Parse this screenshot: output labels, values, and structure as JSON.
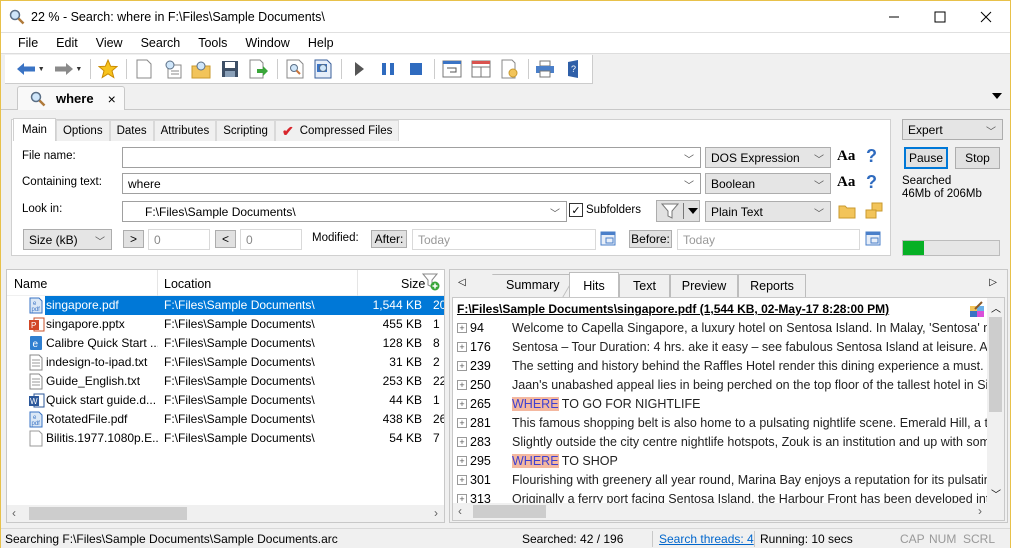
{
  "window": {
    "title": "22 % - Search: where in F:\\Files\\Sample Documents\\",
    "minimize": "—",
    "maximize": "☐",
    "close": "✕"
  },
  "menu": [
    "File",
    "Edit",
    "View",
    "Search",
    "Tools",
    "Window",
    "Help"
  ],
  "toolbar": {
    "icons": [
      "back-icon",
      "forward-icon",
      "favorites-star-icon",
      "new-document-icon",
      "new-search-icon",
      "open-search-icon",
      "save-icon",
      "export-icon",
      "search-file-icon",
      "search-preview-icon",
      "start-icon",
      "pause-icon",
      "stop-icon",
      "layout-icon",
      "window-icon",
      "options-icon",
      "print-icon",
      "help-book-icon"
    ]
  },
  "document_tab": {
    "label": "where",
    "close": "×"
  },
  "criteria": {
    "tabs": [
      "Main",
      "Options",
      "Dates",
      "Attributes",
      "Scripting",
      "Compressed Files"
    ],
    "active_tab": "Main",
    "file_name_label": "File name:",
    "file_name_value": "",
    "file_name_mode": "DOS Expression",
    "containing_text_label": "Containing text:",
    "containing_text_value": "where",
    "containing_text_mode": "Boolean",
    "look_in_label": "Look in:",
    "look_in_value": "F:\\Files\\Sample Documents\\",
    "subfolders_label": "Subfolders",
    "subfolders_checked": true,
    "file_type": "Plain Text",
    "size_filter": "Size (kB)",
    "gt_label": ">",
    "gt_value": "0",
    "lt_label": "<",
    "lt_value": "0",
    "modified_label": "Modified:",
    "after_label": "After:",
    "after_placeholder": "Today",
    "before_label": "Before:",
    "before_placeholder": "Today",
    "case_icon": "Aa",
    "help_icon": "?"
  },
  "side": {
    "mode": "Expert",
    "pause": "Pause",
    "stop": "Stop",
    "searched_line1": "Searched",
    "searched_line2": "46Mb of 206Mb",
    "progress_fraction": 0.22
  },
  "files": {
    "columns": [
      "Name",
      "Location",
      "Size"
    ],
    "rows": [
      {
        "name": "singapore.pdf",
        "location": "F:\\Files\\Sample Documents\\",
        "size": "1,544 KB",
        "hits": "20",
        "type": "pdf",
        "selected": true
      },
      {
        "name": "singapore.pptx",
        "location": "F:\\Files\\Sample Documents\\",
        "size": "455 KB",
        "hits": "1",
        "type": "pptx"
      },
      {
        "name": "Calibre Quick Start ...",
        "location": "F:\\Files\\Sample Documents\\",
        "size": "128 KB",
        "hits": "8",
        "type": "epub"
      },
      {
        "name": "indesign-to-ipad.txt",
        "location": "F:\\Files\\Sample Documents\\",
        "size": "31 KB",
        "hits": "2",
        "type": "txt"
      },
      {
        "name": "Guide_English.txt",
        "location": "F:\\Files\\Sample Documents\\",
        "size": "253 KB",
        "hits": "22",
        "type": "txt"
      },
      {
        "name": "Quick start guide.d...",
        "location": "F:\\Files\\Sample Documents\\",
        "size": "44 KB",
        "hits": "1",
        "type": "docx"
      },
      {
        "name": "RotatedFile.pdf",
        "location": "F:\\Files\\Sample Documents\\",
        "size": "438 KB",
        "hits": "26",
        "type": "pdf"
      },
      {
        "name": "Bilitis.1977.1080p.E...",
        "location": "F:\\Files\\Sample Documents\\",
        "size": "54 KB",
        "hits": "7",
        "type": "file"
      }
    ]
  },
  "results": {
    "tabs": [
      "Summary",
      "Hits",
      "Text",
      "Preview",
      "Reports"
    ],
    "active_tab": "Hits",
    "header": "F:\\Files\\Sample Documents\\singapore.pdf   (1,544 KB,  02-May-17 8:28:00 PM)",
    "hits": [
      {
        "line": "94",
        "pre": "",
        "hit": "",
        "text": "Welcome to Capella Singapore, a luxury hotel on Sentosa Island. In Malay, 'Sentosa' me"
      },
      {
        "line": "176",
        "pre": "",
        "hit": "",
        "text": "Sentosa – Tour Duration: 4 hrs. ake it easy – see fabulous Sentosa Island at leisure. As"
      },
      {
        "line": "239",
        "pre": "",
        "hit": "",
        "text": "The setting and history behind the Raffles Hotel render this dining experience a must. B"
      },
      {
        "line": "250",
        "pre": "",
        "hit": "",
        "text": "Jaan's unabashed appeal lies in being perched on the top floor of the tallest hotel in Sir"
      },
      {
        "line": "265",
        "pre": "",
        "hit": "WHERE",
        "text": " TO GO FOR NIGHTLIFE"
      },
      {
        "line": "281",
        "pre": "",
        "hit": "",
        "text": "This famous shopping belt is also home to a pulsating nightlife scene. Emerald Hill, a t"
      },
      {
        "line": "283",
        "pre": "",
        "hit": "",
        "text": "Slightly outside the city centre nightlife hotspots, Zouk is an institution and up with some"
      },
      {
        "line": "295",
        "pre": "",
        "hit": "WHERE",
        "text": " TO SHOP"
      },
      {
        "line": "301",
        "pre": "",
        "hit": "",
        "text": "Flourishing with greenery all year round, Marina Bay enjoys a reputation for its pulsating"
      },
      {
        "line": "313",
        "pre": "",
        "hit": "",
        "text": "Originally a ferry port facing Sentosa Island, the Harbour Front has been developed into"
      }
    ]
  },
  "status": {
    "searching": "Searching F:\\Files\\Sample Documents\\Sample Documents.arc",
    "searched": "Searched: 42 / 196",
    "threads": "Search threads: 4",
    "running": "Running: 10 secs",
    "cap": "CAP",
    "num": "NUM",
    "scrl": "SCRL"
  },
  "colors": {
    "accent": "#0078d7",
    "progress": "#06b025",
    "hit_bg": "#f4b8a0",
    "hit_fg": "#4040d0"
  }
}
